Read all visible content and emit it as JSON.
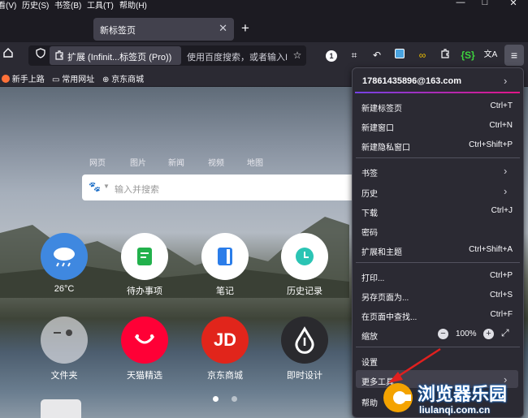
{
  "menubar": {
    "items": [
      "看(V)",
      "历史(S)",
      "书签(B)",
      "工具(T)",
      "帮助(H)"
    ]
  },
  "tab": {
    "title": "新标签页"
  },
  "urlbar": {
    "identity": "扩展 (Infinit...标签页 (Pro))",
    "placeholder": "使用百度搜索，或者输入I"
  },
  "toolbar": {
    "badge": "1"
  },
  "bookmarks": [
    "新手上路",
    "常用网址",
    "京东商城"
  ],
  "newtab": {
    "search_tabs": [
      "网页",
      "图片",
      "新闻",
      "视频",
      "地图"
    ],
    "search_placeholder": "输入并搜索",
    "tiles": [
      {
        "label": "26°C",
        "icon": "weather-icon"
      },
      {
        "label": "待办事项",
        "icon": "todo-icon"
      },
      {
        "label": "笔记",
        "icon": "notes-icon"
      },
      {
        "label": "历史记录",
        "icon": "history-icon"
      },
      {
        "label": "文件夹",
        "icon": "folder-icon"
      },
      {
        "label": "天猫精选",
        "icon": "tmall-icon"
      },
      {
        "label": "京东商城",
        "icon": "jd-icon",
        "icon_text": "JD"
      },
      {
        "label": "即时设计",
        "icon": "jsdesign-icon"
      }
    ],
    "page": 1,
    "pages": 2
  },
  "menu": {
    "account": "17861435896@163.com",
    "items": [
      {
        "label": "新建标签页",
        "shortcut": "Ctrl+T"
      },
      {
        "label": "新建窗口",
        "shortcut": "Ctrl+N"
      },
      {
        "label": "新建隐私窗口",
        "shortcut": "Ctrl+Shift+P"
      },
      {
        "label": "书签",
        "shortcut": ""
      },
      {
        "label": "历史",
        "shortcut": ""
      },
      {
        "label": "下载",
        "shortcut": "Ctrl+J"
      },
      {
        "label": "密码",
        "shortcut": ""
      },
      {
        "label": "扩展和主题",
        "shortcut": "Ctrl+Shift+A"
      },
      {
        "label": "打印...",
        "shortcut": "Ctrl+P"
      },
      {
        "label": "另存页面为...",
        "shortcut": "Ctrl+S"
      },
      {
        "label": "在页面中查找...",
        "shortcut": "Ctrl+F"
      },
      {
        "label": "缩放",
        "shortcut": ""
      },
      {
        "label": "设置",
        "shortcut": ""
      },
      {
        "label": "更多工具",
        "shortcut": ""
      },
      {
        "label": "帮助",
        "shortcut": ""
      }
    ],
    "zoom": "100%"
  },
  "watermark": {
    "title": "浏览器乐园",
    "domain": "liulanqi.com.cn"
  },
  "colors": {
    "accent": "#7542e5",
    "arrow": "#e0201f",
    "panel": "#2b2a33"
  }
}
